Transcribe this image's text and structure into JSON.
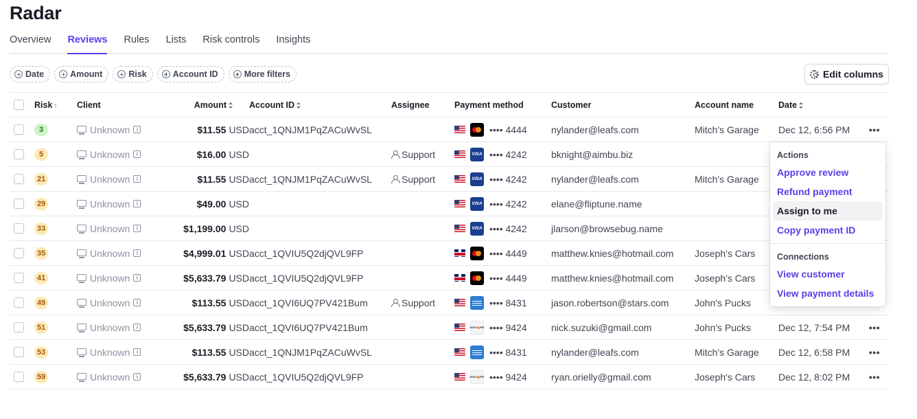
{
  "page": {
    "title": "Radar"
  },
  "tabs": [
    {
      "label": "Overview",
      "active": false
    },
    {
      "label": "Reviews",
      "active": true
    },
    {
      "label": "Rules",
      "active": false
    },
    {
      "label": "Lists",
      "active": false
    },
    {
      "label": "Risk controls",
      "active": false
    },
    {
      "label": "Insights",
      "active": false
    }
  ],
  "filters": [
    {
      "label": "Date"
    },
    {
      "label": "Amount"
    },
    {
      "label": "Risk"
    },
    {
      "label": "Account ID"
    },
    {
      "label": "More filters"
    }
  ],
  "toolbar": {
    "edit_columns_label": "Edit columns",
    "edit_columns_icon": "gear-icon"
  },
  "table": {
    "columns": {
      "risk": "Risk",
      "client": "Client",
      "amount": "Amount",
      "account_id": "Account ID",
      "assignee": "Assignee",
      "payment_method": "Payment method",
      "customer": "Customer",
      "account_name": "Account name",
      "date": "Date"
    },
    "sort": {
      "column": "Risk",
      "direction": "ascending"
    },
    "rows": [
      {
        "risk": "3",
        "risk_level": "low",
        "client": "Unknown",
        "amount": "$11.55",
        "currency": "USD",
        "account_id": "acct_1QNJM1PqZACuWvSL",
        "assignee": "",
        "flag": "us",
        "card": "mastercard",
        "dots": "••••",
        "last4": "4444",
        "customer": "nylander@leafs.com",
        "account_name": "Mitch's Garage",
        "date": "Dec 12, 6:56 PM",
        "more": "•••"
      },
      {
        "risk": "5",
        "risk_level": "medium",
        "client": "Unknown",
        "amount": "$16.00",
        "currency": "USD",
        "account_id": "",
        "assignee": "Support",
        "flag": "us",
        "card": "visa",
        "dots": "••••",
        "last4": "4242",
        "customer": "bknight@aimbu.biz",
        "account_name": "",
        "date": "",
        "more": ""
      },
      {
        "risk": "21",
        "risk_level": "medium",
        "client": "Unknown",
        "amount": "$11.55",
        "currency": "USD",
        "account_id": "acct_1QNJM1PqZACuWvSL",
        "assignee": "Support",
        "flag": "us",
        "card": "visa",
        "dots": "••••",
        "last4": "4242",
        "customer": "nylander@leafs.com",
        "account_name": "Mitch's Garage",
        "date": "",
        "more": ""
      },
      {
        "risk": "29",
        "risk_level": "medium",
        "client": "Unknown",
        "amount": "$49.00",
        "currency": "USD",
        "account_id": "",
        "assignee": "",
        "flag": "us",
        "card": "visa",
        "dots": "••••",
        "last4": "4242",
        "customer": "elane@fliptune.name",
        "account_name": "",
        "date": "",
        "more": ""
      },
      {
        "risk": "33",
        "risk_level": "medium",
        "client": "Unknown",
        "amount": "$1,199.00",
        "currency": "USD",
        "account_id": "",
        "assignee": "",
        "flag": "us",
        "card": "visa",
        "dots": "••••",
        "last4": "4242",
        "customer": "jlarson@browsebug.name",
        "account_name": "",
        "date": "",
        "more": ""
      },
      {
        "risk": "35",
        "risk_level": "medium",
        "client": "Unknown",
        "amount": "$4,999.01",
        "currency": "USD",
        "account_id": "acct_1QVIU5Q2djQVL9FP",
        "assignee": "",
        "flag": "gb",
        "card": "mastercard",
        "dots": "••••",
        "last4": "4449",
        "customer": "matthew.knies@hotmail.com",
        "account_name": "Joseph's Cars",
        "date": "",
        "more": ""
      },
      {
        "risk": "41",
        "risk_level": "medium",
        "client": "Unknown",
        "amount": "$5,633.79",
        "currency": "USD",
        "account_id": "acct_1QVIU5Q2djQVL9FP",
        "assignee": "",
        "flag": "gb",
        "card": "mastercard",
        "dots": "••••",
        "last4": "4449",
        "customer": "matthew.knies@hotmail.com",
        "account_name": "Joseph's Cars",
        "date": "",
        "more": ""
      },
      {
        "risk": "49",
        "risk_level": "medium",
        "client": "Unknown",
        "amount": "$113.55",
        "currency": "USD",
        "account_id": "acct_1QVI6UQ7PV421Bum",
        "assignee": "Support",
        "flag": "us",
        "card": "amex",
        "dots": "••••",
        "last4": "8431",
        "customer": "jason.robertson@stars.com",
        "account_name": "John's Pucks",
        "date": "",
        "more": ""
      },
      {
        "risk": "51",
        "risk_level": "medium",
        "client": "Unknown",
        "amount": "$5,633.79",
        "currency": "USD",
        "account_id": "acct_1QVI6UQ7PV421Bum",
        "assignee": "",
        "flag": "us",
        "card": "discover",
        "dots": "••••",
        "last4": "9424",
        "customer": "nick.suzuki@gmail.com",
        "account_name": "John's Pucks",
        "date": "Dec 12, 7:54 PM",
        "more": "•••"
      },
      {
        "risk": "53",
        "risk_level": "medium",
        "client": "Unknown",
        "amount": "$113.55",
        "currency": "USD",
        "account_id": "acct_1QNJM1PqZACuWvSL",
        "assignee": "",
        "flag": "us",
        "card": "amex",
        "dots": "••••",
        "last4": "8431",
        "customer": "nylander@leafs.com",
        "account_name": "Mitch's Garage",
        "date": "Dec 12, 6:58 PM",
        "more": "•••"
      },
      {
        "risk": "59",
        "risk_level": "medium",
        "client": "Unknown",
        "amount": "$5,633.79",
        "currency": "USD",
        "account_id": "acct_1QVIU5Q2djQVL9FP",
        "assignee": "",
        "flag": "us",
        "card": "discover",
        "dots": "••••",
        "last4": "9424",
        "customer": "ryan.orielly@gmail.com",
        "account_name": "Joseph's Cars",
        "date": "Dec 12, 8:02 PM",
        "more": "•••"
      }
    ]
  },
  "row_menu": {
    "sections": [
      {
        "heading": "Actions",
        "items": [
          {
            "label": "Approve review",
            "hovered": false
          },
          {
            "label": "Refund payment",
            "hovered": false
          },
          {
            "label": "Assign to me",
            "hovered": true
          },
          {
            "label": "Copy payment ID",
            "hovered": false
          }
        ]
      },
      {
        "heading": "Connections",
        "items": [
          {
            "label": "View customer",
            "hovered": false
          },
          {
            "label": "View payment details",
            "hovered": false
          }
        ]
      }
    ]
  },
  "colors": {
    "accent": "#5b3ee8",
    "risk_low_bg": "#cdf5c7",
    "risk_medium_bg": "#fde9b5"
  }
}
